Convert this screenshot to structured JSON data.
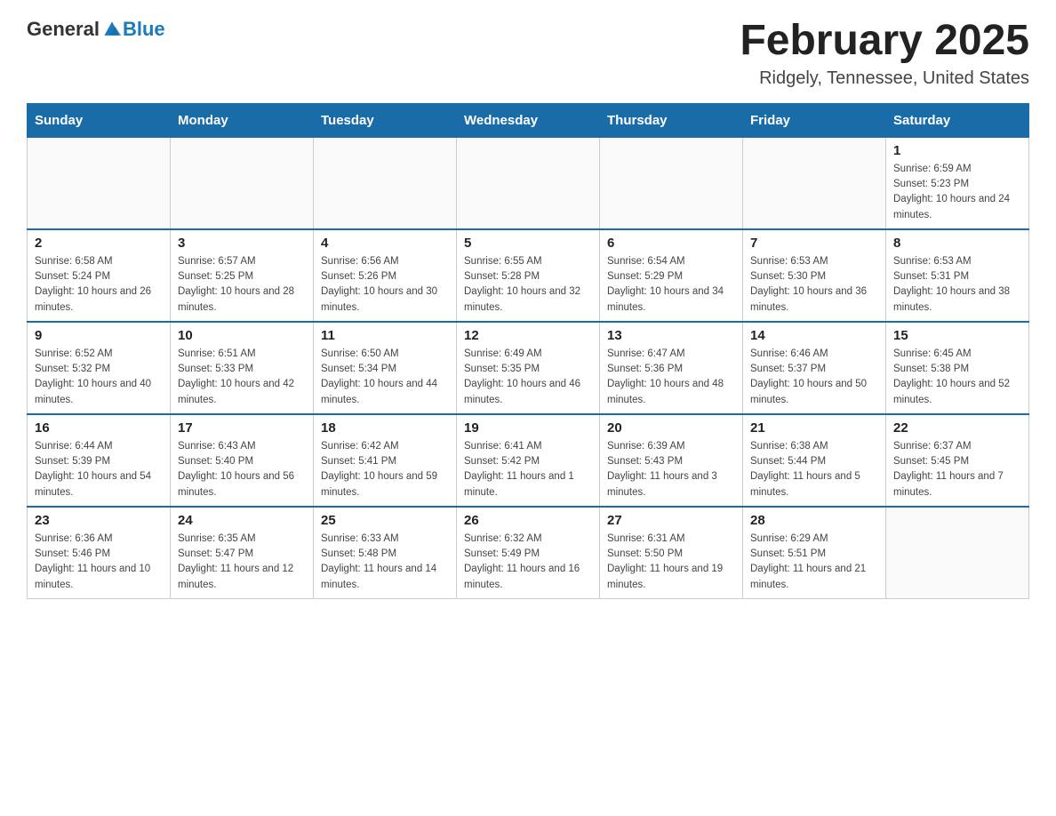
{
  "header": {
    "logo_general": "General",
    "logo_blue": "Blue",
    "month_title": "February 2025",
    "location": "Ridgely, Tennessee, United States"
  },
  "weekdays": [
    "Sunday",
    "Monday",
    "Tuesday",
    "Wednesday",
    "Thursday",
    "Friday",
    "Saturday"
  ],
  "weeks": [
    [
      {
        "day": "",
        "sunrise": "",
        "sunset": "",
        "daylight": ""
      },
      {
        "day": "",
        "sunrise": "",
        "sunset": "",
        "daylight": ""
      },
      {
        "day": "",
        "sunrise": "",
        "sunset": "",
        "daylight": ""
      },
      {
        "day": "",
        "sunrise": "",
        "sunset": "",
        "daylight": ""
      },
      {
        "day": "",
        "sunrise": "",
        "sunset": "",
        "daylight": ""
      },
      {
        "day": "",
        "sunrise": "",
        "sunset": "",
        "daylight": ""
      },
      {
        "day": "1",
        "sunrise": "Sunrise: 6:59 AM",
        "sunset": "Sunset: 5:23 PM",
        "daylight": "Daylight: 10 hours and 24 minutes."
      }
    ],
    [
      {
        "day": "2",
        "sunrise": "Sunrise: 6:58 AM",
        "sunset": "Sunset: 5:24 PM",
        "daylight": "Daylight: 10 hours and 26 minutes."
      },
      {
        "day": "3",
        "sunrise": "Sunrise: 6:57 AM",
        "sunset": "Sunset: 5:25 PM",
        "daylight": "Daylight: 10 hours and 28 minutes."
      },
      {
        "day": "4",
        "sunrise": "Sunrise: 6:56 AM",
        "sunset": "Sunset: 5:26 PM",
        "daylight": "Daylight: 10 hours and 30 minutes."
      },
      {
        "day": "5",
        "sunrise": "Sunrise: 6:55 AM",
        "sunset": "Sunset: 5:28 PM",
        "daylight": "Daylight: 10 hours and 32 minutes."
      },
      {
        "day": "6",
        "sunrise": "Sunrise: 6:54 AM",
        "sunset": "Sunset: 5:29 PM",
        "daylight": "Daylight: 10 hours and 34 minutes."
      },
      {
        "day": "7",
        "sunrise": "Sunrise: 6:53 AM",
        "sunset": "Sunset: 5:30 PM",
        "daylight": "Daylight: 10 hours and 36 minutes."
      },
      {
        "day": "8",
        "sunrise": "Sunrise: 6:53 AM",
        "sunset": "Sunset: 5:31 PM",
        "daylight": "Daylight: 10 hours and 38 minutes."
      }
    ],
    [
      {
        "day": "9",
        "sunrise": "Sunrise: 6:52 AM",
        "sunset": "Sunset: 5:32 PM",
        "daylight": "Daylight: 10 hours and 40 minutes."
      },
      {
        "day": "10",
        "sunrise": "Sunrise: 6:51 AM",
        "sunset": "Sunset: 5:33 PM",
        "daylight": "Daylight: 10 hours and 42 minutes."
      },
      {
        "day": "11",
        "sunrise": "Sunrise: 6:50 AM",
        "sunset": "Sunset: 5:34 PM",
        "daylight": "Daylight: 10 hours and 44 minutes."
      },
      {
        "day": "12",
        "sunrise": "Sunrise: 6:49 AM",
        "sunset": "Sunset: 5:35 PM",
        "daylight": "Daylight: 10 hours and 46 minutes."
      },
      {
        "day": "13",
        "sunrise": "Sunrise: 6:47 AM",
        "sunset": "Sunset: 5:36 PM",
        "daylight": "Daylight: 10 hours and 48 minutes."
      },
      {
        "day": "14",
        "sunrise": "Sunrise: 6:46 AM",
        "sunset": "Sunset: 5:37 PM",
        "daylight": "Daylight: 10 hours and 50 minutes."
      },
      {
        "day": "15",
        "sunrise": "Sunrise: 6:45 AM",
        "sunset": "Sunset: 5:38 PM",
        "daylight": "Daylight: 10 hours and 52 minutes."
      }
    ],
    [
      {
        "day": "16",
        "sunrise": "Sunrise: 6:44 AM",
        "sunset": "Sunset: 5:39 PM",
        "daylight": "Daylight: 10 hours and 54 minutes."
      },
      {
        "day": "17",
        "sunrise": "Sunrise: 6:43 AM",
        "sunset": "Sunset: 5:40 PM",
        "daylight": "Daylight: 10 hours and 56 minutes."
      },
      {
        "day": "18",
        "sunrise": "Sunrise: 6:42 AM",
        "sunset": "Sunset: 5:41 PM",
        "daylight": "Daylight: 10 hours and 59 minutes."
      },
      {
        "day": "19",
        "sunrise": "Sunrise: 6:41 AM",
        "sunset": "Sunset: 5:42 PM",
        "daylight": "Daylight: 11 hours and 1 minute."
      },
      {
        "day": "20",
        "sunrise": "Sunrise: 6:39 AM",
        "sunset": "Sunset: 5:43 PM",
        "daylight": "Daylight: 11 hours and 3 minutes."
      },
      {
        "day": "21",
        "sunrise": "Sunrise: 6:38 AM",
        "sunset": "Sunset: 5:44 PM",
        "daylight": "Daylight: 11 hours and 5 minutes."
      },
      {
        "day": "22",
        "sunrise": "Sunrise: 6:37 AM",
        "sunset": "Sunset: 5:45 PM",
        "daylight": "Daylight: 11 hours and 7 minutes."
      }
    ],
    [
      {
        "day": "23",
        "sunrise": "Sunrise: 6:36 AM",
        "sunset": "Sunset: 5:46 PM",
        "daylight": "Daylight: 11 hours and 10 minutes."
      },
      {
        "day": "24",
        "sunrise": "Sunrise: 6:35 AM",
        "sunset": "Sunset: 5:47 PM",
        "daylight": "Daylight: 11 hours and 12 minutes."
      },
      {
        "day": "25",
        "sunrise": "Sunrise: 6:33 AM",
        "sunset": "Sunset: 5:48 PM",
        "daylight": "Daylight: 11 hours and 14 minutes."
      },
      {
        "day": "26",
        "sunrise": "Sunrise: 6:32 AM",
        "sunset": "Sunset: 5:49 PM",
        "daylight": "Daylight: 11 hours and 16 minutes."
      },
      {
        "day": "27",
        "sunrise": "Sunrise: 6:31 AM",
        "sunset": "Sunset: 5:50 PM",
        "daylight": "Daylight: 11 hours and 19 minutes."
      },
      {
        "day": "28",
        "sunrise": "Sunrise: 6:29 AM",
        "sunset": "Sunset: 5:51 PM",
        "daylight": "Daylight: 11 hours and 21 minutes."
      },
      {
        "day": "",
        "sunrise": "",
        "sunset": "",
        "daylight": ""
      }
    ]
  ]
}
